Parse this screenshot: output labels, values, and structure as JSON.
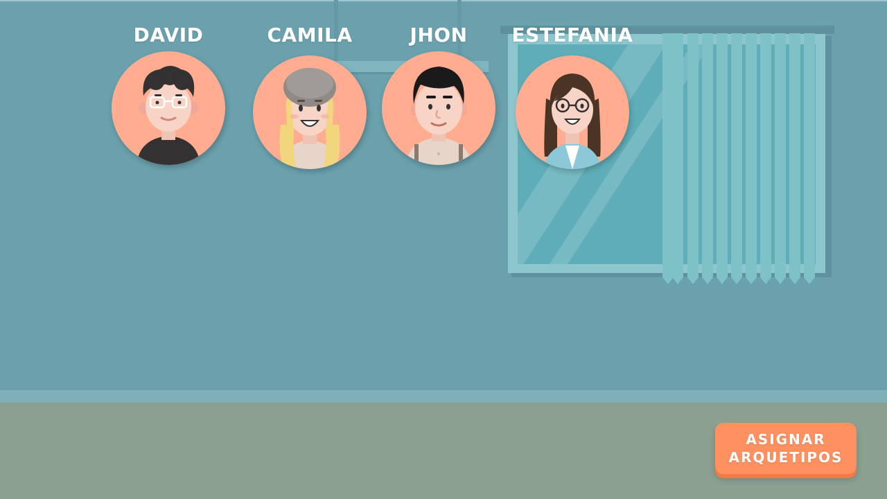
{
  "people": [
    {
      "name": "DAVID"
    },
    {
      "name": "CAMILA"
    },
    {
      "name": "JHON"
    },
    {
      "name": "ESTEFANIA"
    }
  ],
  "assign_button": {
    "label": "ASIGNAR\nARQUETIPOS"
  },
  "colors": {
    "wall": "#6aa1ad",
    "floor": "#8ba090",
    "avatar_bg": "#ffac90",
    "button": "#ff9060"
  }
}
